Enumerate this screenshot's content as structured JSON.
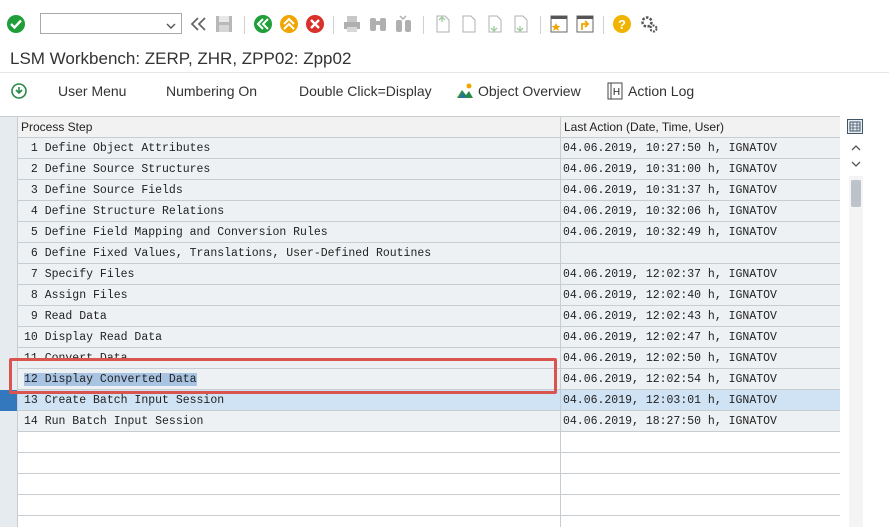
{
  "toolbar": {
    "command_field_value": "",
    "icons": [
      "enter-icon",
      "command-dropdown-icon",
      "collapse-toolbar-icon",
      "save-icon",
      "back-icon",
      "exit-icon",
      "cancel-icon",
      "print-icon",
      "find-icon",
      "find-next-icon",
      "first-page-icon",
      "previous-page-icon",
      "next-page-icon",
      "last-page-icon",
      "new-session-icon",
      "create-shortcut-icon",
      "help-icon",
      "customize-layout-icon"
    ]
  },
  "title": "LSM Workbench: ZERP, ZHR, ZPP02: Zpp02",
  "app_toolbar": {
    "user_menu": "User Menu",
    "numbering_on": "Numbering On",
    "double_click": "Double Click=Display",
    "object_overview": "Object Overview",
    "action_log": "Action Log"
  },
  "table": {
    "headers": {
      "process_step": "Process Step",
      "last_action": "Last Action (Date, Time, User)"
    },
    "rows": [
      {
        "step": " 1 Define Object Attributes",
        "last": "04.06.2019, 10:27:50 h, IGNATOV"
      },
      {
        "step": " 2 Define Source Structures",
        "last": "04.06.2019, 10:31:00 h, IGNATOV"
      },
      {
        "step": " 3 Define Source Fields",
        "last": "04.06.2019, 10:31:37 h, IGNATOV"
      },
      {
        "step": " 4 Define Structure Relations",
        "last": "04.06.2019, 10:32:06 h, IGNATOV"
      },
      {
        "step": " 5 Define Field Mapping and Conversion Rules",
        "last": "04.06.2019, 10:32:49 h, IGNATOV"
      },
      {
        "step": " 6 Define Fixed Values, Translations, User-Defined Routines",
        "last": ""
      },
      {
        "step": " 7 Specify Files",
        "last": "04.06.2019, 12:02:37 h, IGNATOV"
      },
      {
        "step": " 8 Assign Files",
        "last": "04.06.2019, 12:02:40 h, IGNATOV"
      },
      {
        "step": " 9 Read Data",
        "last": "04.06.2019, 12:02:43 h, IGNATOV"
      },
      {
        "step": "10 Display Read Data",
        "last": "04.06.2019, 12:02:47 h, IGNATOV"
      },
      {
        "step": "11 Convert Data",
        "last": "04.06.2019, 12:02:50 h, IGNATOV"
      },
      {
        "step": "12 Display Converted Data",
        "last": "04.06.2019, 12:02:54 h, IGNATOV"
      },
      {
        "step": "13 Create Batch Input Session",
        "last": "04.06.2019, 12:03:01 h, IGNATOV"
      },
      {
        "step": "14 Run Batch Input Session",
        "last": "04.06.2019, 18:27:50 h, IGNATOV"
      }
    ],
    "selected_row": 13,
    "focused_row": 12
  },
  "colors": {
    "enter_green": "#1f9e3a",
    "nav_green": "#1f9e3a",
    "nav_orange": "#f0a500",
    "cancel_red": "#d9302a",
    "help_yellow": "#f0b400",
    "highlight_red": "#d9534f",
    "selection_blue": "#3378bd"
  }
}
